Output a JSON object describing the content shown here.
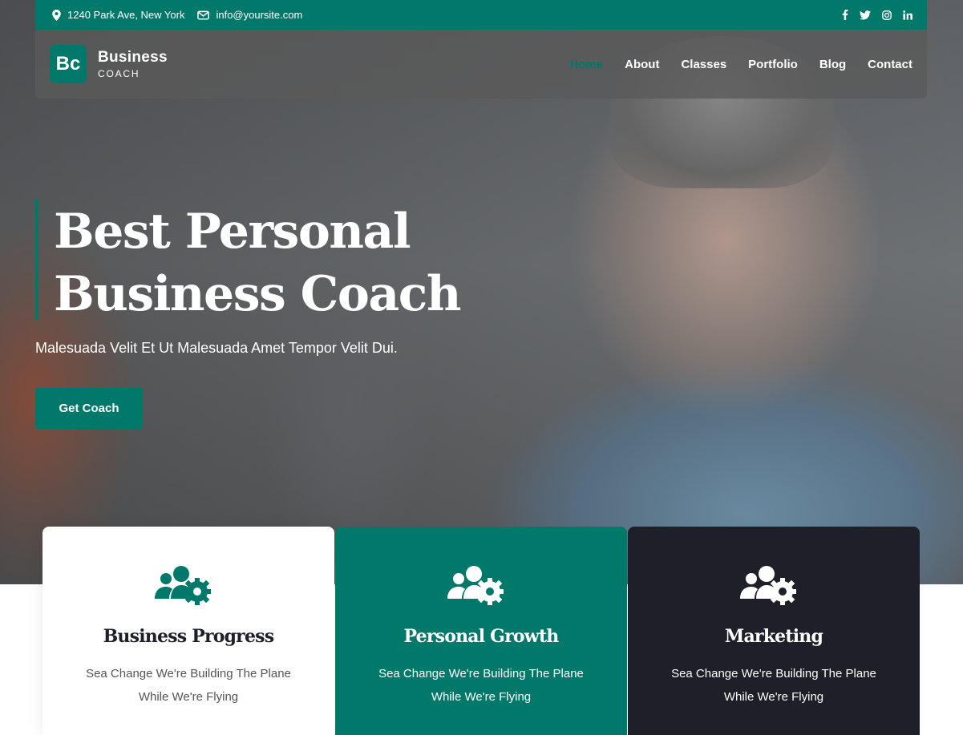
{
  "topbar": {
    "address": "1240 Park Ave, New York",
    "email": "info@yoursite.com",
    "social": [
      {
        "icon": "facebook-icon",
        "glyph": "f"
      },
      {
        "icon": "twitter-icon",
        "glyph": "t"
      },
      {
        "icon": "instagram-icon",
        "glyph": "ig"
      },
      {
        "icon": "linkedin-icon",
        "glyph": "in"
      }
    ]
  },
  "logo": {
    "mark": "Bc",
    "name": "Business",
    "tagline": "COACH"
  },
  "nav": {
    "items": [
      "Home",
      "About",
      "Classes",
      "Portfolio",
      "Blog",
      "Contact"
    ],
    "active": "Home"
  },
  "hero": {
    "title_line1": "Best Personal",
    "title_line2": "Business Coach",
    "subtitle": "Malesuada Velit Et Ut Malesuada Amet Tempor Velit Dui.",
    "button": "Get Coach"
  },
  "cards": [
    {
      "title": "Business Progress",
      "text": "Sea Change We're Building The Plane While We're Flying",
      "icon": "team-settings-icon",
      "bg": "#ffffff"
    },
    {
      "title": "Personal Growth",
      "text": "Sea Change We're Building The Plane While We're Flying",
      "icon": "team-settings-icon",
      "bg": "#00796b"
    },
    {
      "title": "Marketing",
      "text": "Sea Change We're Building The Plane While We're Flying",
      "icon": "team-settings-icon",
      "bg": "#1e1f29"
    }
  ],
  "colors": {
    "primary": "#00796b",
    "dark": "#1e1f29"
  }
}
